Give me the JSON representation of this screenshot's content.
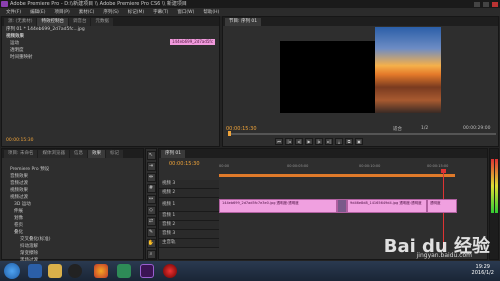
{
  "window": {
    "title": "Adobe Premiere Pro - D:\\\\新建项目 \\\\ Adobe Premiere Pro CS6 \\\\ 新建项目"
  },
  "menu": {
    "items": [
      "文件(F)",
      "编辑(E)",
      "项目(P)",
      "素材(C)",
      "序列(S)",
      "标记(M)",
      "字幕(T)",
      "窗口(W)",
      "帮助(H)"
    ]
  },
  "source_panel": {
    "tabs": [
      "源: (无素材)",
      "特效控制台",
      "调音台",
      "元数据"
    ],
    "clip_label": "序列 01 * 144eb699_2d7ad5fc...jpg",
    "clip_chip": "144eb699_2d7ad5fc",
    "rows": [
      "视频效果",
      "运动",
      "透明度",
      "时间重映射"
    ],
    "timecode": "00:00:15:30"
  },
  "program_panel": {
    "tab": "节目: 序列 01",
    "timecode_left": "00:00:15:30",
    "fit": "适合",
    "ratio": "1/2",
    "timecode_right": "00:00:29:00",
    "controls": [
      "⏮",
      "|◂",
      "◂|",
      "▶",
      "|▸",
      "▸|",
      "⤓",
      "⧉",
      "▣"
    ]
  },
  "project_panel": {
    "tabs": [
      "项目: 未命名",
      "媒体浏览器",
      "信息",
      "效果",
      "标记"
    ],
    "items": [
      "Premiere Pro 预设",
      "音频效果",
      "音频过渡",
      "视频效果",
      "视频过渡",
      "3D 运动",
      "伸展",
      "划像",
      "卷页",
      "叠化",
      "交叉叠化(标准)",
      "抖动溶解",
      "渐变擦除",
      "黑场过渡"
    ]
  },
  "timeline": {
    "tab": "序列 01",
    "timecode": "00:00:15:30",
    "ruler": [
      "00:00",
      "00:00:05:00",
      "00:00:10:00",
      "00:00:15:00"
    ],
    "tracks": [
      {
        "name": "视频 3"
      },
      {
        "name": "视频 2"
      },
      {
        "name": "视频 1"
      },
      {
        "name": "音频 1"
      },
      {
        "name": "音频 2"
      },
      {
        "name": "音频 3"
      },
      {
        "name": "主音轨"
      }
    ],
    "clips": [
      "144eb699_2d7ad5fc7e3e0.jpg 透明度:透明度",
      "9d46e8d8_14165649d4.jpg 透明度:透明度",
      "透明度"
    ]
  },
  "watermark": {
    "text": "Bai du 经验",
    "url": "jingyan.baidu.com"
  },
  "clock": {
    "time": "19:29",
    "date": "2016/1/2"
  },
  "colors": {
    "accent": "#4aa3ff",
    "timecode": "#f0a43a",
    "clip": "#f0a0e0"
  }
}
